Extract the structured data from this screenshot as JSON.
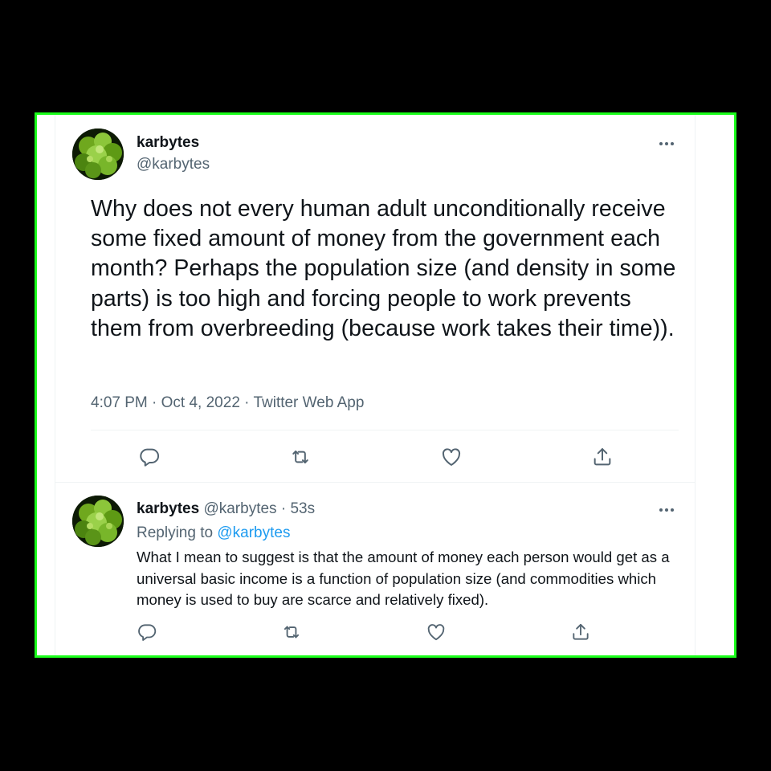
{
  "tweet": {
    "author_name": "karbytes",
    "author_handle": "@karbytes",
    "text": "Why does not every human adult unconditionally receive some fixed amount of money from the government each month? Perhaps the population size (and density in some parts) is too high and forcing people to work prevents them from overbreeding (because work takes their time)).",
    "time": "4:07 PM",
    "date": "Oct 4, 2022",
    "source": "Twitter Web App",
    "separator": "·"
  },
  "reply": {
    "author_name": "karbytes",
    "author_handle": "@karbytes",
    "separator": "·",
    "age": "53s",
    "replying_to_label": "Replying to",
    "replying_to_handle": "@karbytes",
    "text": "What I mean to suggest is that the amount of money each person would get as a universal basic income is a function of population size (and commodities which money is used to buy are scarce and relatively fixed)."
  },
  "icons": {
    "more": "more-horizontal-icon",
    "reply": "reply-icon",
    "retweet": "retweet-icon",
    "like": "heart-icon",
    "share": "share-icon"
  },
  "colors": {
    "frame_border": "#1bff1b",
    "text": "#0f1419",
    "secondary": "#536471",
    "link": "#1d9bf0",
    "divider": "#eff3f4"
  }
}
